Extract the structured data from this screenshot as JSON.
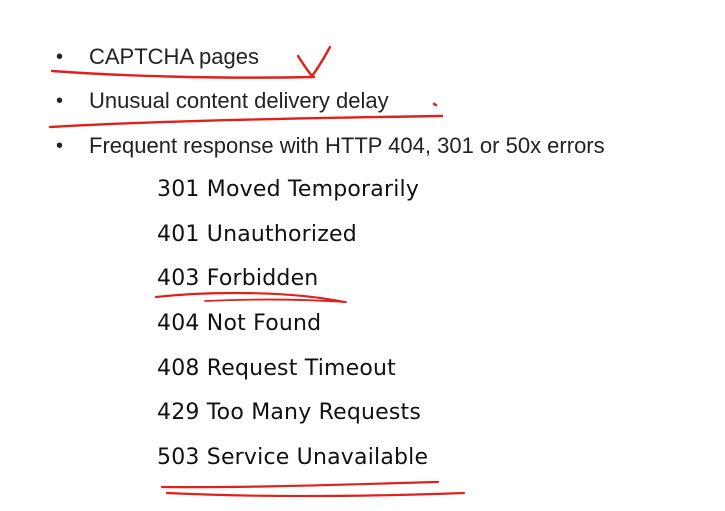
{
  "bullets": [
    {
      "text": "CAPTCHA pages"
    },
    {
      "text": "Unusual content delivery delay"
    },
    {
      "text": "Frequent response with HTTP 404, 301 or 50x errors"
    }
  ],
  "bullet_marker": "•",
  "status_codes": [
    {
      "text": "301 Moved Temporarily"
    },
    {
      "text": "401 Unauthorized"
    },
    {
      "text": "403 Forbidden"
    },
    {
      "text": "404 Not Found"
    },
    {
      "text": "408 Request Timeout"
    },
    {
      "text": "429 Too Many Requests"
    },
    {
      "text": "503 Service Unavailable"
    }
  ],
  "annotation_color": "#e0201a"
}
